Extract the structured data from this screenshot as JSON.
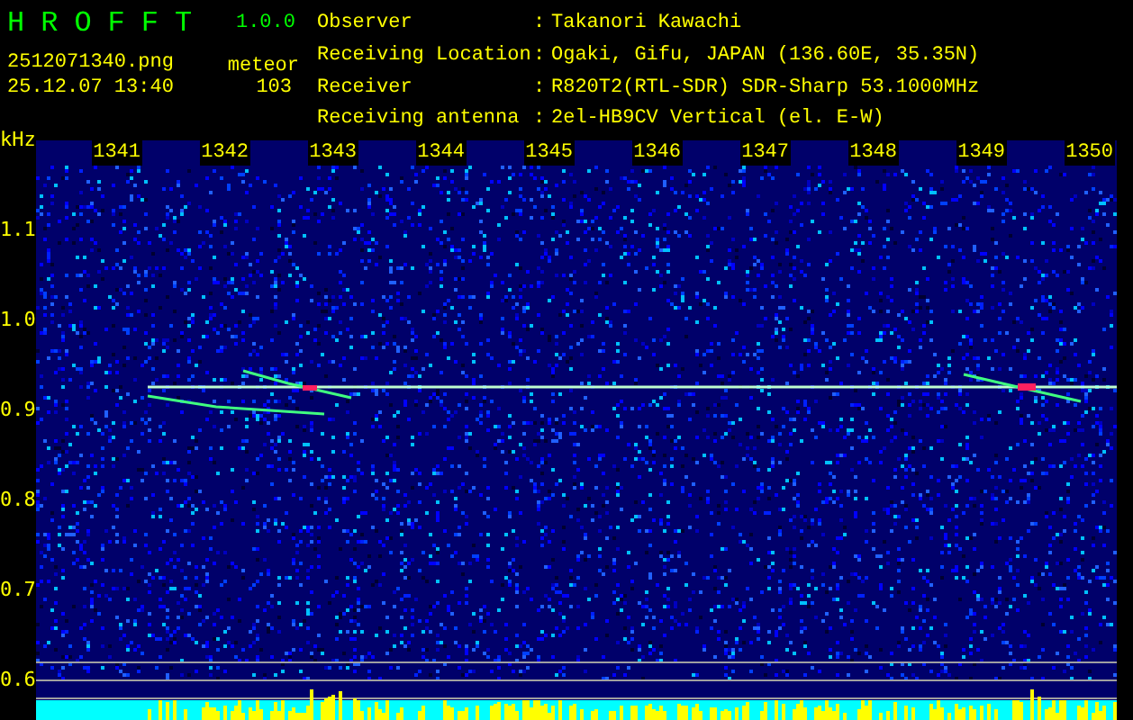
{
  "header": {
    "app_name": "HROFFT",
    "version": "1.0.0",
    "file_name": "2512071340.png",
    "timestamp": "25.12.07 13:40",
    "counter_label": "meteor",
    "counter_value": "103"
  },
  "station_info": [
    {
      "label": "Observer",
      "separator": ":",
      "value": "Takanori Kawachi"
    },
    {
      "label": "Receiving Location",
      "separator": ":",
      "value": "Ogaki, Gifu, JAPAN (136.60E, 35.35N)"
    },
    {
      "label": "Receiver",
      "separator": ":",
      "value": "R820T2(RTL-SDR) SDR-Sharp 53.1000MHz"
    },
    {
      "label": "Receiving antenna",
      "separator": ":",
      "value": "2el-HB9CV Vertical (el. E-W)"
    }
  ],
  "spectrogram": {
    "y_unit": "kHz",
    "y_labels": [
      "1.1",
      "1.0",
      "0.9",
      "0.8",
      "0.7",
      "0.6"
    ],
    "x_labels": [
      "1341",
      "1342",
      "1343",
      "1344",
      "1345",
      "1346",
      "1347",
      "1348",
      "1349",
      "1350"
    ]
  }
}
